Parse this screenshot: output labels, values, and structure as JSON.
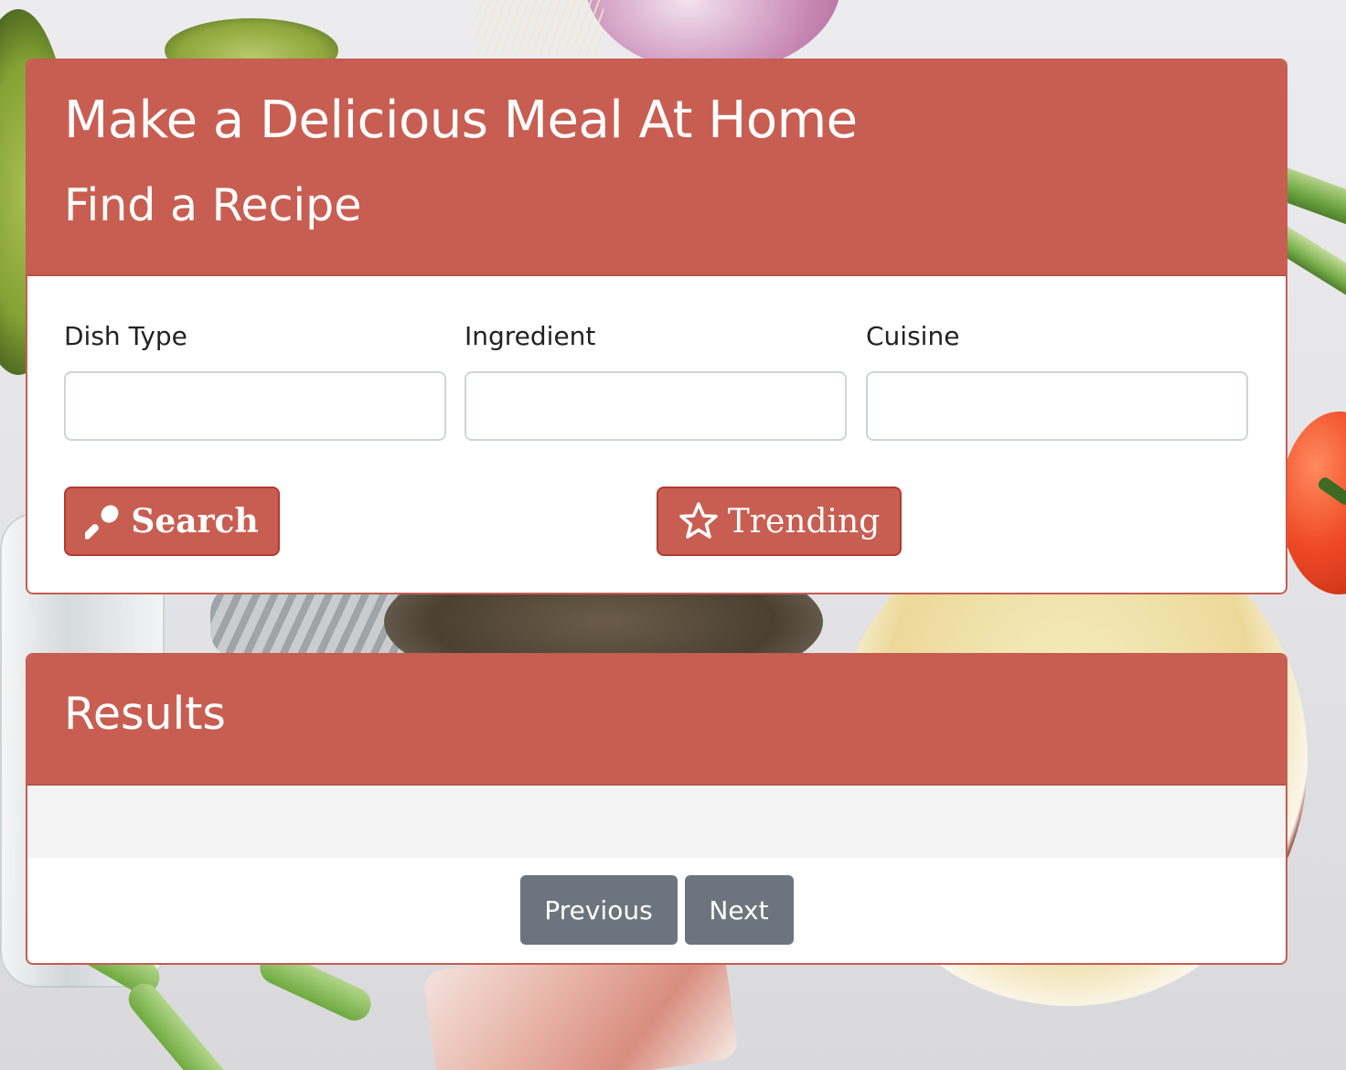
{
  "header": {
    "title": "Make a Delicious Meal At Home",
    "subtitle": "Find a Recipe"
  },
  "search_form": {
    "dish_type": {
      "label": "Dish Type",
      "value": "",
      "placeholder": ""
    },
    "ingredient": {
      "label": "Ingredient",
      "value": "",
      "placeholder": ""
    },
    "cuisine": {
      "label": "Cuisine",
      "value": "",
      "placeholder": ""
    },
    "search_button": {
      "label": "Search",
      "icon": "spoon-icon"
    },
    "trending_button": {
      "label": "Trending",
      "icon": "star-icon"
    }
  },
  "results": {
    "title": "Results",
    "items": [],
    "previous_label": "Previous",
    "next_label": "Next"
  },
  "colors": {
    "accent": "#c85e51",
    "accent_border": "#b23b30",
    "pager_button": "#6c757d",
    "results_bg": "#f3f3f3"
  }
}
